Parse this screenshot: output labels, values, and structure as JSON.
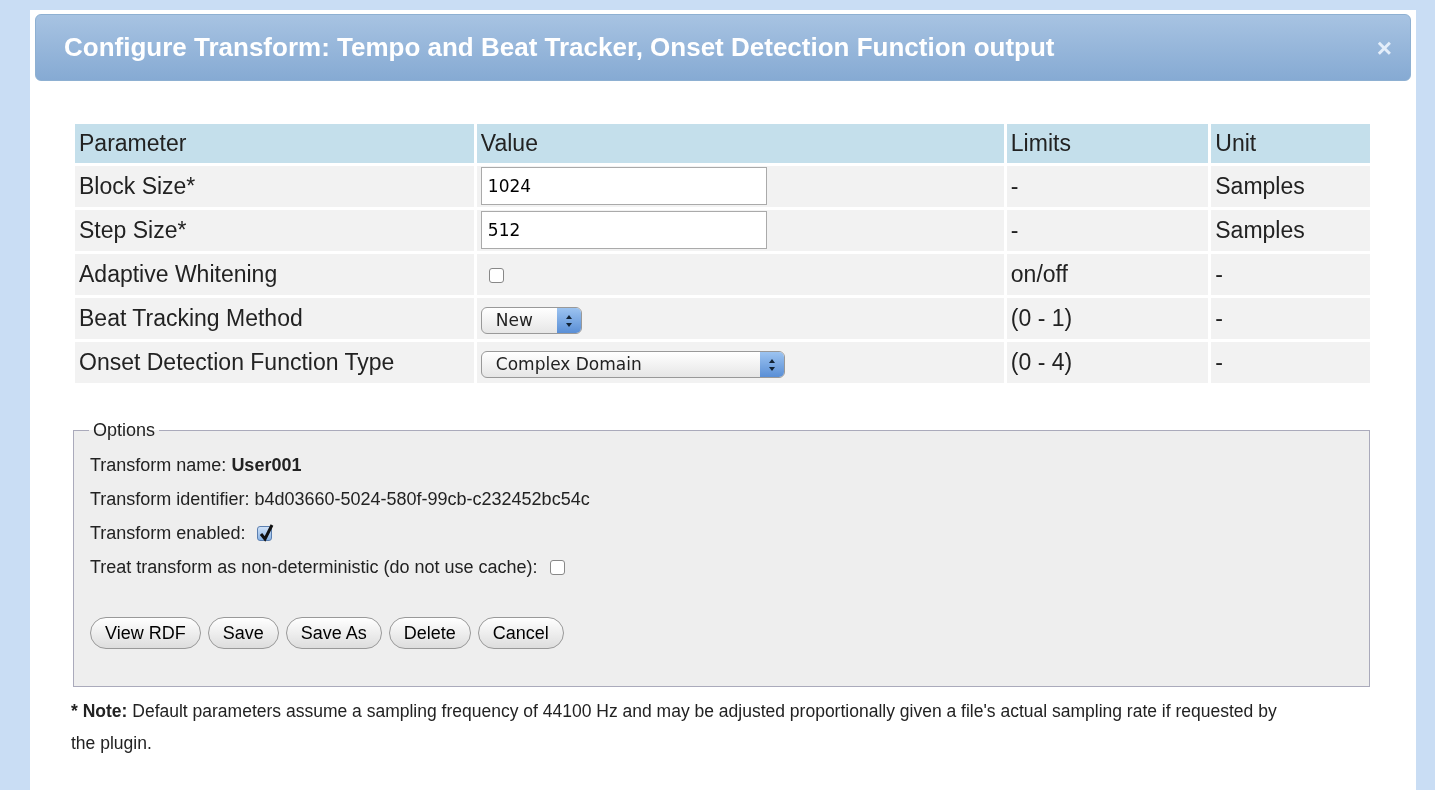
{
  "dialog": {
    "title": "Configure Transform: Tempo and Beat Tracker, Onset Detection Function output",
    "close": "×"
  },
  "table": {
    "columns": [
      "Parameter",
      "Value",
      "Limits",
      "Unit"
    ],
    "rows": [
      {
        "parameter": "Block Size*",
        "kind": "text",
        "value": "1024",
        "limits": "-",
        "unit": "Samples"
      },
      {
        "parameter": "Step Size*",
        "kind": "text",
        "value": "512",
        "limits": "-",
        "unit": "Samples"
      },
      {
        "parameter": "Adaptive Whitening",
        "kind": "checkbox",
        "checked": false,
        "limits": "on/off",
        "unit": "-"
      },
      {
        "parameter": "Beat Tracking Method",
        "kind": "select",
        "value": "New",
        "limits": "(0 - 1)",
        "unit": "-"
      },
      {
        "parameter": "Onset Detection Function Type",
        "kind": "select",
        "value": "Complex Domain",
        "limits": "(0 - 4)",
        "unit": "-"
      }
    ]
  },
  "options": {
    "legend": "Options",
    "lines": [
      {
        "kind": "text",
        "text": "Transform name: **User001**"
      },
      {
        "kind": "text",
        "text": "Transform identifier: b4d03660-5024-580f-99cb-c232452bc54c"
      },
      {
        "kind": "checkbox",
        "text": "Transform enabled:",
        "checked": true
      },
      {
        "kind": "checkbox",
        "text": "Treat transform as non-deterministic (do not use cache):",
        "checked": false
      }
    ],
    "buttons": [
      "View RDF",
      "Save",
      "Save As",
      "Delete",
      "Cancel"
    ]
  },
  "note": {
    "marker": "*",
    "text": "**Note:** Default parameters assume a sampling frequency of 44100 Hz and may be adjusted proportionally given a file's actual sampling rate if requested by the plugin."
  }
}
